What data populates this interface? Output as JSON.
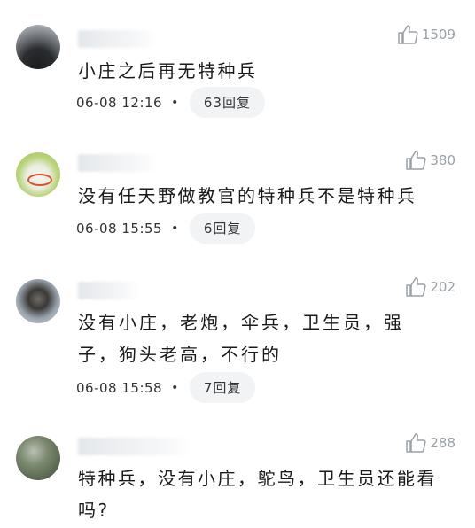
{
  "comments": [
    {
      "text": "小庄之后再无特种兵",
      "date": "06-08 12:16",
      "dot": "•",
      "replies": "63回复",
      "likes": "1509"
    },
    {
      "text": "没有任天野做教官的特种兵不是特种兵",
      "date": "06-08 15:55",
      "dot": "•",
      "replies": "6回复",
      "likes": "380"
    },
    {
      "text": "没有小庄，老炮，伞兵，卫生员，强子，狗头老高，不行的",
      "date": "06-08 15:58",
      "dot": "•",
      "replies": "7回复",
      "likes": "202"
    },
    {
      "text": "特种兵，没有小庄，鸵鸟，卫生员还能看吗?",
      "likes": "288"
    }
  ],
  "icons": {
    "like": "thumbs-up-icon"
  },
  "colors": {
    "text": "#1a1a1a",
    "muted": "#9aa0a6",
    "reply_bg": "#f2f3f5"
  }
}
